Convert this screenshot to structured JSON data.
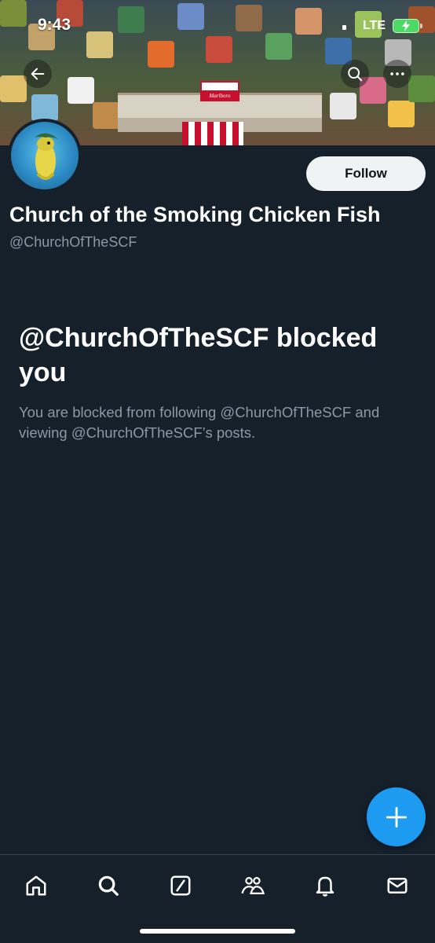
{
  "status_bar": {
    "time": "9:43",
    "network": "LTE"
  },
  "banner": {
    "pack_label": "Marlboro"
  },
  "profile": {
    "display_name": "Church of the Smoking Chicken Fish",
    "handle": "@ChurchOfTheSCF",
    "follow_label": "Follow"
  },
  "blocked": {
    "title": "@ChurchOfTheSCF blocked you",
    "description": "You are blocked from following @ChurchOfTheSCF and viewing @ChurchOfTheSCF’s posts."
  },
  "icons": {
    "back": "arrow-left-icon",
    "search": "search-icon",
    "more": "more-icon",
    "compose": "plus-icon",
    "tabs": [
      "home-icon",
      "search-icon",
      "grok-icon",
      "communities-icon",
      "notifications-icon",
      "messages-icon"
    ]
  },
  "colors": {
    "accent": "#1d9bf0",
    "background": "#15202b",
    "secondary_text": "#8b98a5"
  }
}
